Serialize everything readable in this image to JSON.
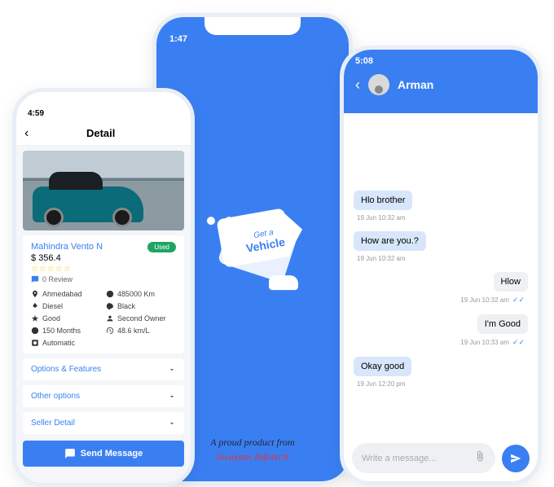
{
  "leftPhone": {
    "time": "4:59",
    "header": "Detail",
    "vehicle": {
      "name": "Mahindra Vento N",
      "badge": "Used",
      "price": "$ 356.4",
      "reviewCount": "0  Review"
    },
    "specs": {
      "location": "Ahmedabad",
      "km": "485000 Km",
      "fuel": "Diesel",
      "color": "Black",
      "condition": "Good",
      "owner": "Second Owner",
      "months": "150 Months",
      "mileage": "48.6 km/L",
      "transmission": "Automatic"
    },
    "accordions": [
      "Options & Features",
      "Other options",
      "Seller Detail"
    ],
    "sendBtn": "Send Message"
  },
  "centerPhone": {
    "time": "1:47",
    "logoLine1": "Get a",
    "logoLine2": "Vehicle",
    "footer1": "A proud product from",
    "footer2": "Swayam Infotech"
  },
  "rightPhone": {
    "time": "5:08",
    "contact": "Arman",
    "messages": [
      {
        "text": "Hlo brother",
        "ts": "19 Jun  10:32 am",
        "in": true
      },
      {
        "text": "How are you.?",
        "ts": "19 Jun  10:32 am",
        "in": true
      },
      {
        "text": "Hlow",
        "ts": "19 Jun  10:32 am",
        "in": false
      },
      {
        "text": "I'm Good",
        "ts": "19 Jun  10:33 am",
        "in": false
      },
      {
        "text": "Okay good",
        "ts": "19 Jun  12:20 pm",
        "in": true
      }
    ],
    "inputPlaceholder": "Write a message..."
  }
}
